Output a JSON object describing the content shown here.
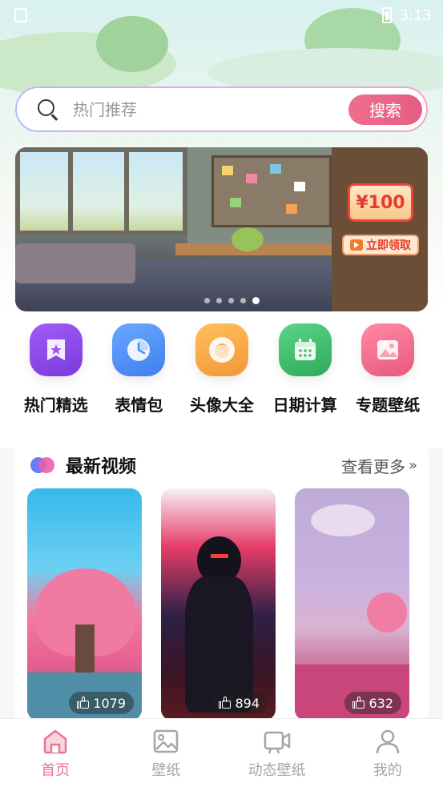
{
  "status_bar": {
    "time": "3:13"
  },
  "search": {
    "placeholder": "热门推荐",
    "button_label": "搜索"
  },
  "banner": {
    "coupon_amount": "¥100",
    "coupon_button": "立即领取",
    "dots_count": 5,
    "active_dot_index": 4
  },
  "quick_actions": [
    {
      "label": "热门精选",
      "icon": "star-bookmark-icon",
      "color": "#8b47e6"
    },
    {
      "label": "表情包",
      "icon": "pie-chart-icon",
      "color": "#4a8cf5"
    },
    {
      "label": "头像大全",
      "icon": "avatar-icon",
      "color": "#f5a341"
    },
    {
      "label": "日期计算",
      "icon": "calendar-icon",
      "color": "#3fbe6b"
    },
    {
      "label": "专题壁纸",
      "icon": "picture-icon",
      "color": "#ef6c8f"
    }
  ],
  "latest_videos": {
    "title": "最新视频",
    "more_label": "查看更多",
    "items": [
      {
        "likes": "1079"
      },
      {
        "likes": "894"
      },
      {
        "likes": "632"
      }
    ]
  },
  "tabbar": {
    "items": [
      {
        "label": "首页",
        "icon": "home-icon",
        "active": true
      },
      {
        "label": "壁纸",
        "icon": "image-icon",
        "active": false
      },
      {
        "label": "动态壁纸",
        "icon": "video-icon",
        "active": false
      },
      {
        "label": "我的",
        "icon": "user-icon",
        "active": false
      }
    ]
  },
  "colors": {
    "accent": "#e8668a",
    "tab_active": "#e87595",
    "tab_inactive": "#a5a5a5"
  }
}
